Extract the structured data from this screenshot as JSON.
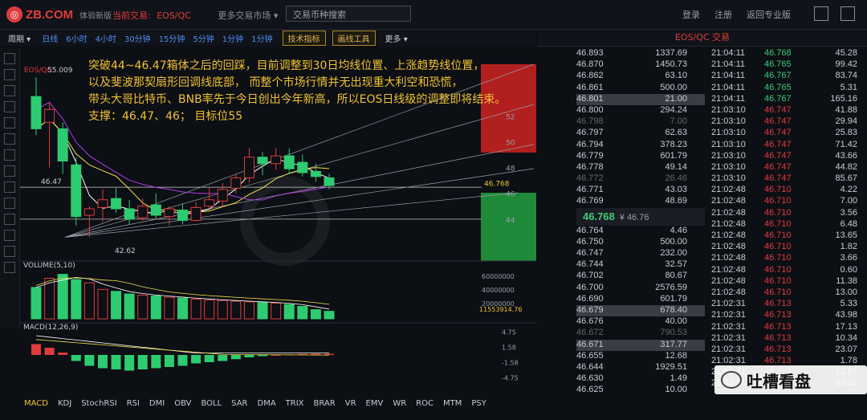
{
  "header": {
    "logo_text": "ZB.COM",
    "logo_sub": "体验新版",
    "nav_label": "当前交易:",
    "nav_pair": "EOS/QC",
    "market_menu": "更多交易市场 ▾",
    "search_placeholder": "交易币种搜索",
    "login": "登录",
    "register": "注册",
    "pro": "返回专业版"
  },
  "toolbar": {
    "period": "周期 ▾",
    "intervals": [
      "日线",
      "6小时",
      "4小时",
      "30分钟",
      "15分钟",
      "5分钟",
      "1分钟",
      "1分钟"
    ],
    "tech": "技术指标",
    "draw": "画线工具",
    "more": "更多 ▾"
  },
  "annotation": [
    "突破44~46.47箱体之后的回踩，目前调整到30日均线位置、上涨趋势线位置，",
    "以及斐波那契扇形回调线底部，   而整个市场行情并无出现重大利空和恐慌，",
    "带头大哥比特币、BNB率先于今日创出今年新高，所以EOS日线级的调整即将结束。",
    "支撑：46.47、46；          目标位55"
  ],
  "chart_labels": {
    "pair_tag": "EOS/QC",
    "high": "55.009",
    "low": "42.62",
    "support_line": "46.47",
    "current_price": "46.768",
    "volume_title": "VOLUME(5,10)",
    "volume_current": "11553914.76",
    "macd_title": "MACD(12,26,9)"
  },
  "chart_data": [
    {
      "type": "candlestick",
      "title": "EOS/QC",
      "y_ticks": [
        "52",
        "50",
        "48",
        "46",
        "44"
      ],
      "candles": [
        {
          "o": 53.5,
          "h": 55.0,
          "l": 50.5,
          "c": 51.0
        },
        {
          "o": 51.5,
          "h": 53.0,
          "l": 48.0,
          "c": 52.5
        },
        {
          "o": 51.0,
          "h": 51.5,
          "l": 47.5,
          "c": 48.5
        },
        {
          "o": 48.2,
          "h": 48.8,
          "l": 43.5,
          "c": 44.2
        },
        {
          "o": 44.3,
          "h": 45.0,
          "l": 42.6,
          "c": 44.8
        },
        {
          "o": 44.9,
          "h": 46.3,
          "l": 43.8,
          "c": 45.5
        },
        {
          "o": 45.6,
          "h": 46.4,
          "l": 44.5,
          "c": 44.8
        },
        {
          "o": 44.8,
          "h": 45.5,
          "l": 43.6,
          "c": 44.0
        },
        {
          "o": 44.1,
          "h": 45.6,
          "l": 43.9,
          "c": 45.0
        },
        {
          "o": 45.1,
          "h": 46.0,
          "l": 44.0,
          "c": 44.3
        },
        {
          "o": 44.2,
          "h": 45.0,
          "l": 43.5,
          "c": 44.8
        },
        {
          "o": 44.7,
          "h": 45.2,
          "l": 43.6,
          "c": 43.9
        },
        {
          "o": 43.9,
          "h": 45.3,
          "l": 43.8,
          "c": 44.9
        },
        {
          "o": 45.0,
          "h": 46.5,
          "l": 44.8,
          "c": 45.5
        },
        {
          "o": 45.4,
          "h": 46.8,
          "l": 44.9,
          "c": 46.3
        },
        {
          "o": 46.4,
          "h": 47.5,
          "l": 46.0,
          "c": 47.2
        },
        {
          "o": 47.2,
          "h": 49.5,
          "l": 46.8,
          "c": 48.8
        },
        {
          "o": 48.8,
          "h": 49.2,
          "l": 47.4,
          "c": 48.3
        },
        {
          "o": 48.3,
          "h": 49.5,
          "l": 47.8,
          "c": 48.9
        },
        {
          "o": 48.9,
          "h": 49.5,
          "l": 47.5,
          "c": 47.9
        },
        {
          "o": 48.4,
          "h": 49.0,
          "l": 47.3,
          "c": 47.6
        },
        {
          "o": 47.7,
          "h": 48.3,
          "l": 46.9,
          "c": 47.3
        },
        {
          "o": 47.2,
          "h": 47.5,
          "l": 46.3,
          "c": 46.6
        }
      ],
      "volume": [
        48,
        62,
        68,
        60,
        55,
        45,
        42,
        38,
        36,
        35,
        33,
        32,
        30,
        29,
        28,
        27,
        26,
        25,
        24,
        22,
        19,
        14,
        11.5
      ],
      "macd_hist": [
        0.9,
        0.6,
        0.2,
        -0.5,
        -0.9,
        -1.1,
        -1.2,
        -1.3,
        -1.2,
        -1.1,
        -1.0,
        -0.9,
        -0.7,
        -0.6,
        -0.5,
        -0.35,
        -0.2,
        -0.1,
        0.0,
        0.05,
        0.08,
        0.1,
        0.1
      ],
      "macd_ticks": [
        "4.75",
        "1.58",
        "-1.58",
        "-4.75"
      ],
      "volume_ticks": [
        "60000000",
        "40000000",
        "20000000"
      ]
    }
  ],
  "orderbook": {
    "title": "EOS/QC 交易",
    "asks": [
      {
        "p": "46.893",
        "q": "1337.69"
      },
      {
        "p": "46.870",
        "q": "1450.73"
      },
      {
        "p": "46.862",
        "q": "63.10"
      },
      {
        "p": "46.861",
        "q": "500.00"
      },
      {
        "p": "46.801",
        "q": "21.00",
        "hl": true
      },
      {
        "p": "46.800",
        "q": "294.24"
      },
      {
        "p": "46.798",
        "q": "7.00",
        "dim": true
      },
      {
        "p": "46.797",
        "q": "62.63"
      },
      {
        "p": "46.794",
        "q": "378.23"
      },
      {
        "p": "46.779",
        "q": "601.79"
      },
      {
        "p": "46.778",
        "q": "49.14"
      },
      {
        "p": "46.772",
        "q": "26.46",
        "dim": true
      },
      {
        "p": "46.771",
        "q": "43.03"
      },
      {
        "p": "46.769",
        "q": "48.69"
      }
    ],
    "last_price": "46.768",
    "last_cny": "¥ 46.76",
    "bids": [
      {
        "p": "46.764",
        "q": "4.46"
      },
      {
        "p": "46.750",
        "q": "500.00"
      },
      {
        "p": "46.747",
        "q": "232.00"
      },
      {
        "p": "46.744",
        "q": "32.57"
      },
      {
        "p": "46.702",
        "q": "80.67"
      },
      {
        "p": "46.700",
        "q": "2576.59"
      },
      {
        "p": "46.690",
        "q": "601.79"
      },
      {
        "p": "46.679",
        "q": "678.40",
        "hl": true
      },
      {
        "p": "46.676",
        "q": "40.00"
      },
      {
        "p": "46.672",
        "q": "790.53",
        "dim": true
      },
      {
        "p": "46.671",
        "q": "317.77",
        "hl": true
      },
      {
        "p": "46.655",
        "q": "12.68"
      },
      {
        "p": "46.644",
        "q": "1929.51"
      },
      {
        "p": "46.630",
        "q": "1.49"
      },
      {
        "p": "46.625",
        "q": "10.00"
      }
    ]
  },
  "trades": [
    {
      "t": "21:04:11",
      "p": "46.768",
      "v": "45.28",
      "d": "up"
    },
    {
      "t": "21:04:11",
      "p": "46.765",
      "v": "99.42",
      "d": "up"
    },
    {
      "t": "21:04:11",
      "p": "46.767",
      "v": "83.74",
      "d": "up"
    },
    {
      "t": "21:04:11",
      "p": "46.765",
      "v": "5.31",
      "d": "up"
    },
    {
      "t": "21:04:11",
      "p": "46.767",
      "v": "165.16",
      "d": "up"
    },
    {
      "t": "21:03:10",
      "p": "46.747",
      "v": "41.88",
      "d": "down"
    },
    {
      "t": "21:03:10",
      "p": "46.747",
      "v": "29.94",
      "d": "down"
    },
    {
      "t": "21:03:10",
      "p": "46.747",
      "v": "25.83",
      "d": "down"
    },
    {
      "t": "21:03:10",
      "p": "46.747",
      "v": "71.42",
      "d": "down"
    },
    {
      "t": "21:03:10",
      "p": "46.747",
      "v": "43.66",
      "d": "down"
    },
    {
      "t": "21:03:10",
      "p": "46.747",
      "v": "44.82",
      "d": "down"
    },
    {
      "t": "21:03:10",
      "p": "46.747",
      "v": "85.67",
      "d": "down"
    },
    {
      "t": "21:02:48",
      "p": "46.710",
      "v": "4.22",
      "d": "down"
    },
    {
      "t": "21:02:48",
      "p": "46.710",
      "v": "7.00",
      "d": "down"
    },
    {
      "t": "21:02:48",
      "p": "46.710",
      "v": "3.56",
      "d": "down"
    },
    {
      "t": "21:02:48",
      "p": "46.710",
      "v": "6.48",
      "d": "down"
    },
    {
      "t": "21:02:48",
      "p": "46.710",
      "v": "13.65",
      "d": "down"
    },
    {
      "t": "21:02:48",
      "p": "46.710",
      "v": "1.82",
      "d": "down"
    },
    {
      "t": "21:02:48",
      "p": "46.710",
      "v": "3.66",
      "d": "down"
    },
    {
      "t": "21:02:48",
      "p": "46.710",
      "v": "0.60",
      "d": "down"
    },
    {
      "t": "21:02:48",
      "p": "46.710",
      "v": "11.38",
      "d": "down"
    },
    {
      "t": "21:02:48",
      "p": "46.710",
      "v": "13.00",
      "d": "down"
    },
    {
      "t": "21:02:31",
      "p": "46.713",
      "v": "5.33",
      "d": "down"
    },
    {
      "t": "21:02:31",
      "p": "46.713",
      "v": "43.98",
      "d": "down"
    },
    {
      "t": "21:02:31",
      "p": "46.713",
      "v": "17.13",
      "d": "down"
    },
    {
      "t": "21:02:31",
      "p": "46.713",
      "v": "10.34",
      "d": "down"
    },
    {
      "t": "21:02:31",
      "p": "46.713",
      "v": "23.07",
      "d": "down"
    },
    {
      "t": "21:02:31",
      "p": "46.713",
      "v": "1.78",
      "d": "down"
    },
    {
      "t": "21:02:31",
      "p": "46.713",
      "v": "13.87",
      "d": "down"
    },
    {
      "t": "21:02:31",
      "p": "46.714",
      "v": "33.02",
      "d": "down"
    }
  ],
  "indicator_tabs": [
    "MACD",
    "KDJ",
    "StochRSI",
    "RSI",
    "DMI",
    "OBV",
    "BOLL",
    "SAR",
    "DMA",
    "TRIX",
    "BRAR",
    "VR",
    "EMV",
    "WR",
    "ROC",
    "MTM",
    "PSY"
  ],
  "watermark": "吐槽看盘",
  "colors": {
    "up": "#3ecc7a",
    "down": "#e03c3c",
    "accent": "#f1c232"
  }
}
